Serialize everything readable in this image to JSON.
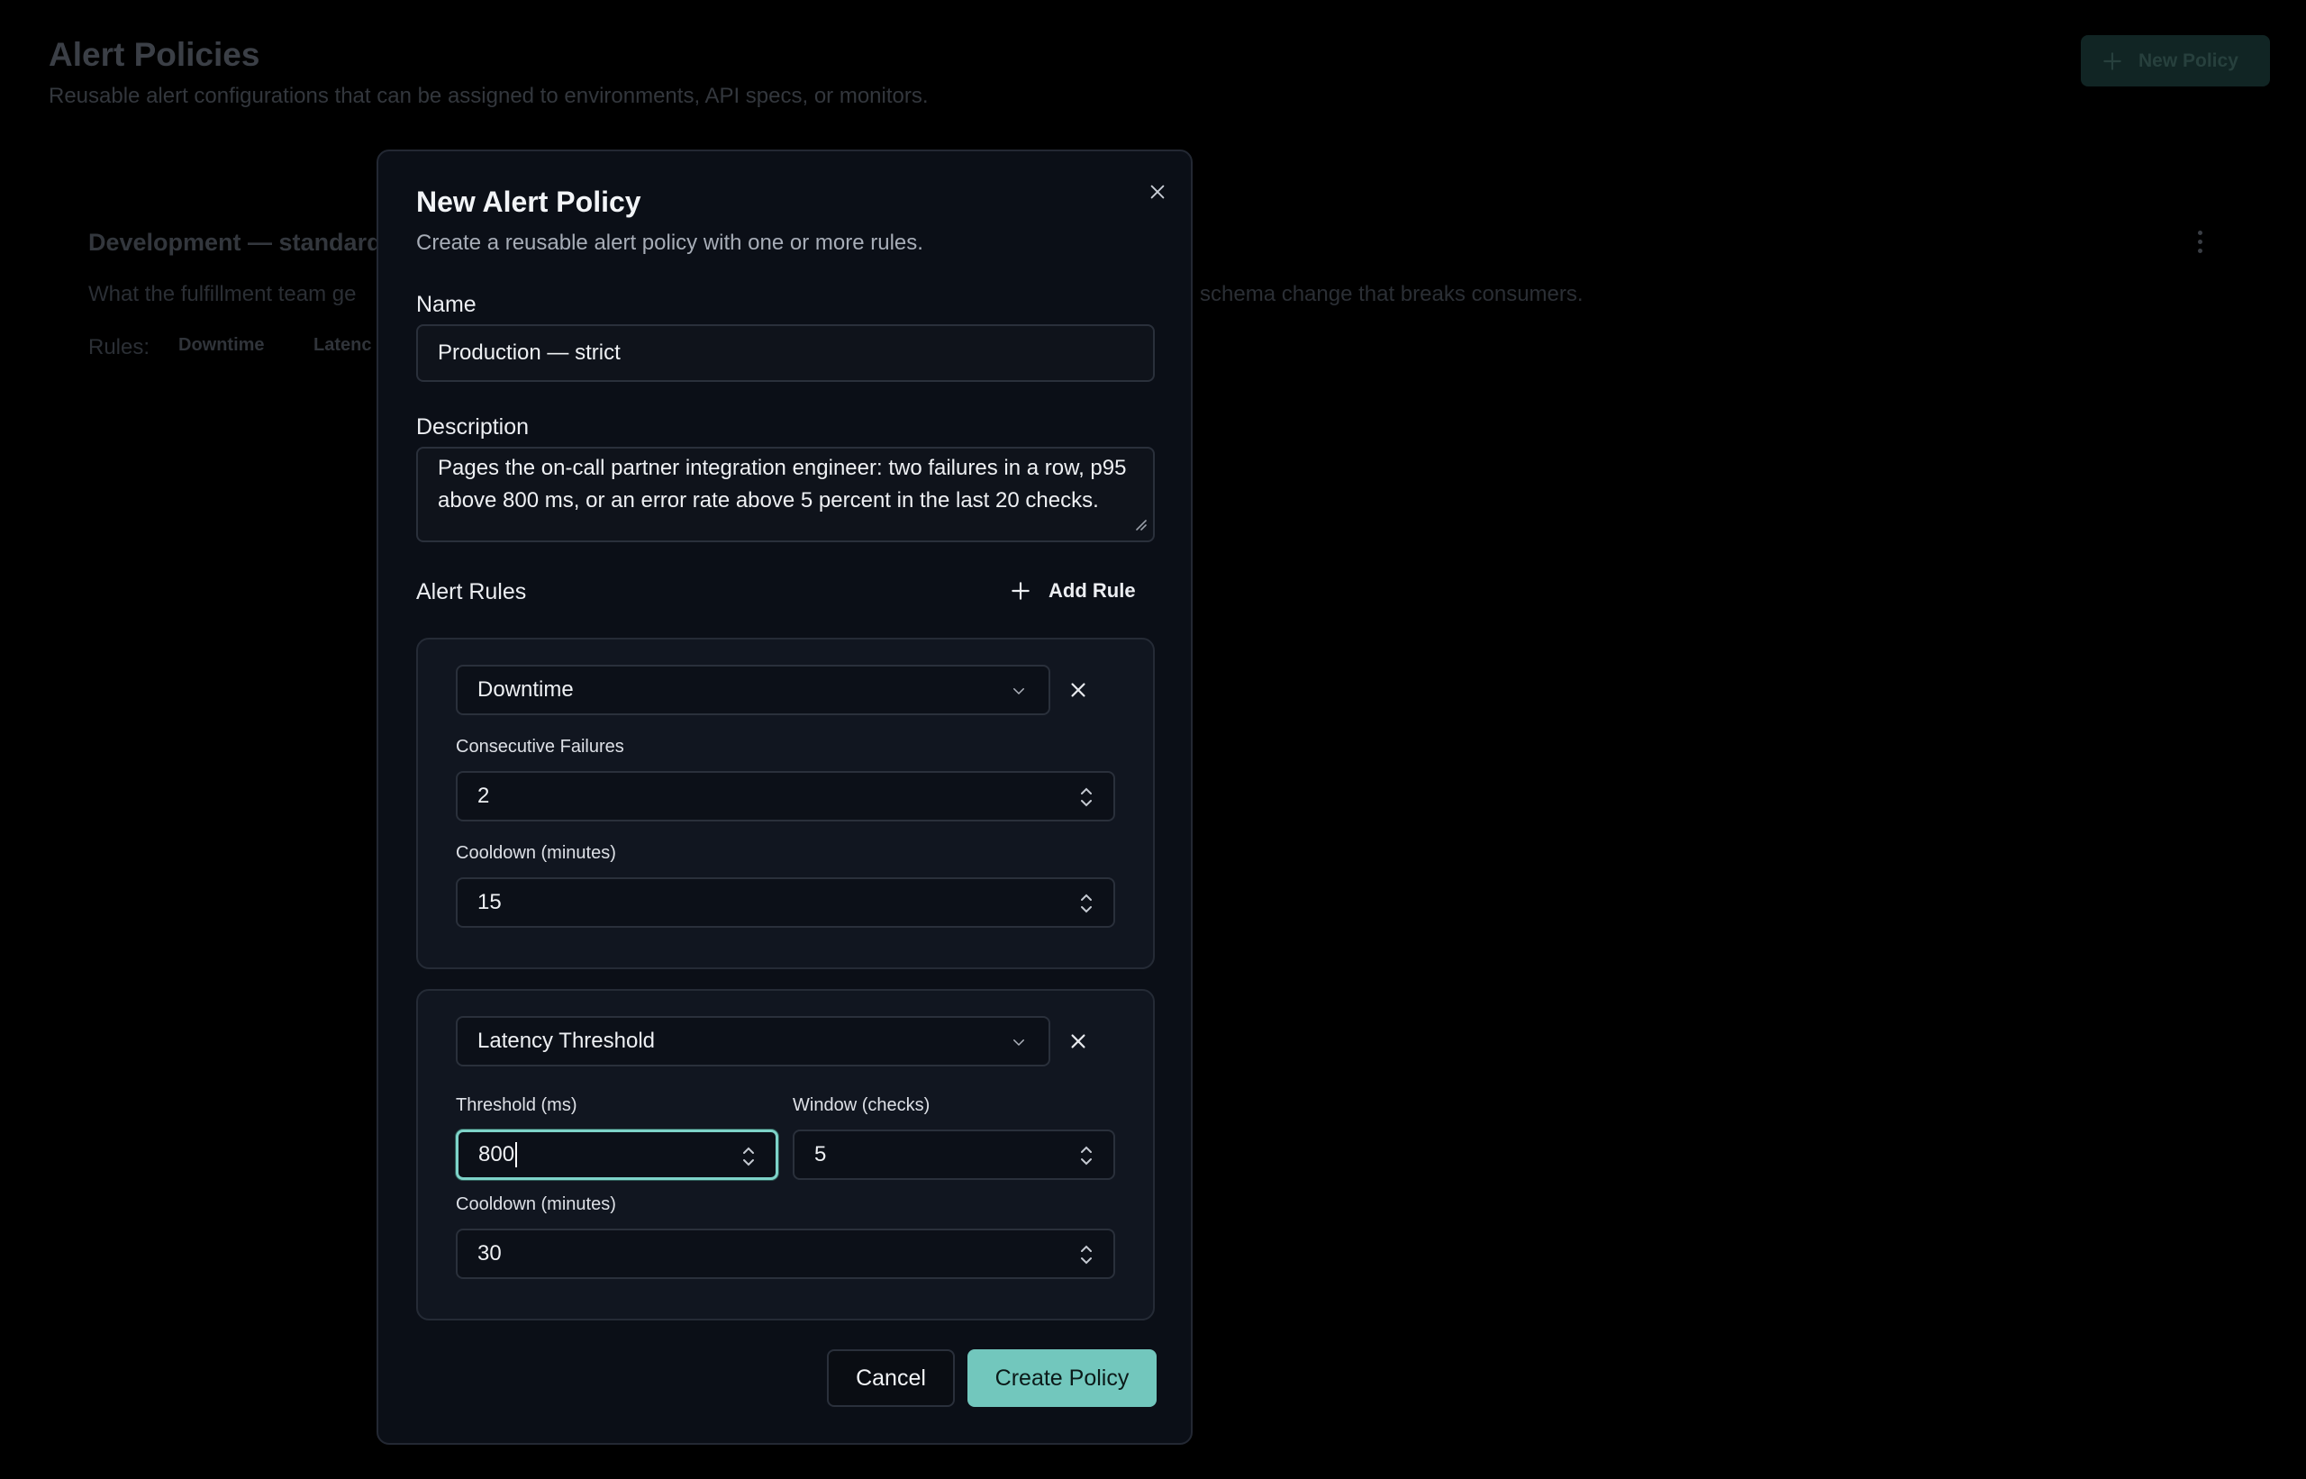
{
  "page": {
    "title": "Alert Policies",
    "subtitle": "Reusable alert configurations that can be assigned to environments, API specs, or monitors.",
    "new_policy_label": "New Policy"
  },
  "policy_card": {
    "title": "Development — standard",
    "description_left": "What the fulfillment team ge",
    "description_right": "schema change that breaks consumers.",
    "rules_label": "Rules:",
    "rules": [
      "Downtime",
      "Latenc"
    ]
  },
  "modal": {
    "title": "New Alert Policy",
    "subtitle": "Create a reusable alert policy with one or more rules.",
    "name_label": "Name",
    "name_value": "Production — strict",
    "description_label": "Description",
    "description_value": "Pages the on-call partner integration engineer: two failures in a row, p95 above 800 ms, or an error rate above 5 percent in the last 20 checks.",
    "alert_rules_label": "Alert Rules",
    "add_rule_label": "Add Rule",
    "rules": [
      {
        "type": "Downtime",
        "consecutive_failures_label": "Consecutive Failures",
        "consecutive_failures": "2",
        "cooldown_label": "Cooldown (minutes)",
        "cooldown": "15"
      },
      {
        "type": "Latency Threshold",
        "threshold_label": "Threshold (ms)",
        "threshold": "800",
        "window_label": "Window (checks)",
        "window": "5",
        "cooldown_label": "Cooldown (minutes)",
        "cooldown": "30"
      }
    ],
    "cancel_label": "Cancel",
    "create_label": "Create Policy"
  },
  "colors": {
    "accent": "#72c7bd",
    "focus_ring": "#7ed3c9",
    "modal_bg": "#0b0f17",
    "page_bg": "#000000"
  },
  "icons": [
    "plus-icon",
    "close-icon",
    "chevron-down-icon",
    "spinner-updown-icon",
    "kebab-menu-icon",
    "resize-grip-icon"
  ]
}
